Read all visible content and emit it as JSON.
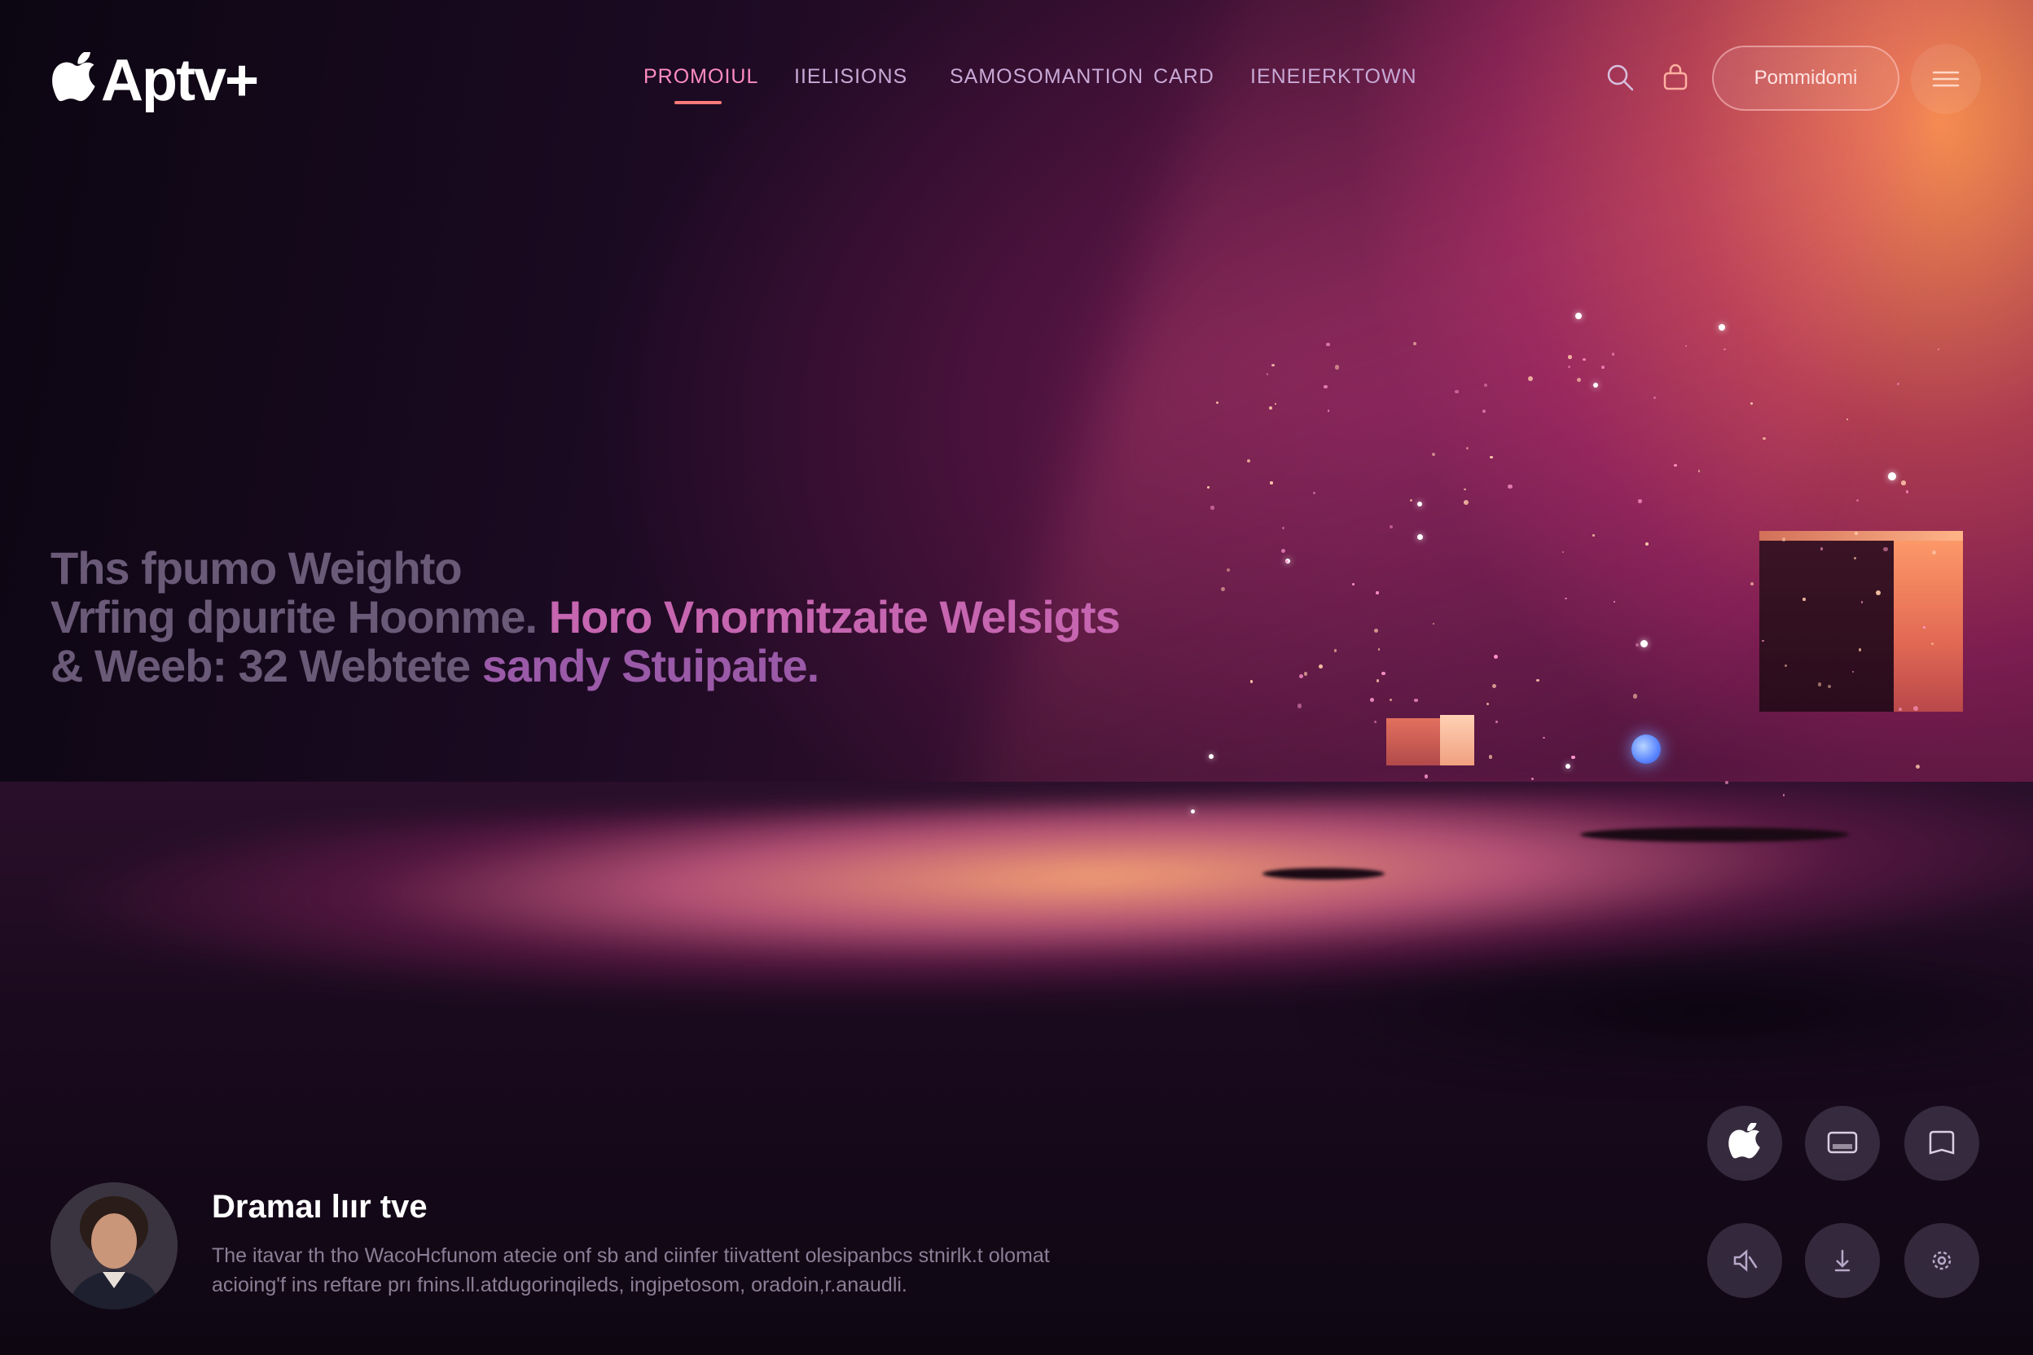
{
  "brand": {
    "logo_text": "Aptv+"
  },
  "nav": {
    "items": [
      {
        "label": "PROMOIUL",
        "active": true
      },
      {
        "label": "IIELISIONS",
        "active": false
      },
      {
        "label": "SAMOSOMANTION",
        "active": false
      },
      {
        "label": "CARD",
        "active": false
      },
      {
        "label": "IENEIERKTOWN",
        "active": false
      }
    ]
  },
  "header_actions": {
    "search_icon": "search-icon",
    "bag_icon": "bag-icon",
    "cta_label": "Pommidomi",
    "menu_icon": "hamburger-menu-icon"
  },
  "hero": {
    "line1": "Ths fpumo Weightо",
    "line2_a": "Vrfing dpurite Hoonme.",
    "line2_b": "Horo Vnormitzaite Welsigts",
    "line3_a": "& Weeb: 32 Webtete",
    "line3_b": "sandy Stuipaite."
  },
  "feature": {
    "title": "Dramaı lıır tve",
    "desc_line1": "The itavar th tho WacoHcfunom atecie onf sb and ciinfer tiivattent olesipanbcs stnirlk.t olomat",
    "desc_line2": "acioing'f ins reftare prı fnins.ll.atdugorinqileds, ingipetosom, oradoin,r.anaudli."
  },
  "quick_actions": {
    "row1": [
      "apple-icon",
      "tv-screen-icon",
      "tablet-icon"
    ],
    "row2": [
      "mute-icon",
      "download-icon",
      "settings-icon"
    ]
  },
  "colors": {
    "accent": "#ff7a7a",
    "nav_active": "#ff8cc0",
    "headline_highlight": "#c665b0"
  }
}
